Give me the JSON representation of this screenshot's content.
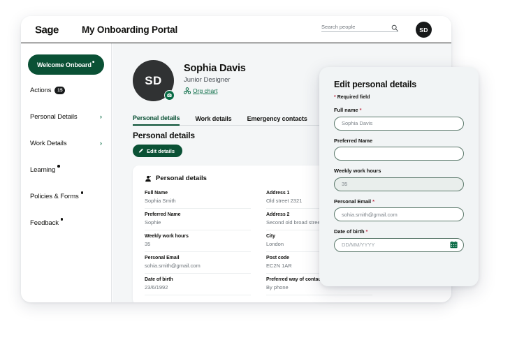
{
  "header": {
    "title": "My Onboarding Portal",
    "logo": "sage-logo",
    "user_initials": "SD",
    "search": {
      "placeholder": "Search people",
      "value": ""
    }
  },
  "sidebar": {
    "welcome": {
      "label": "Welcome Onboard",
      "has_dot": true,
      "active": true,
      "background_color": "#0a5135"
    },
    "items": [
      {
        "label": "Actions",
        "badge": "15"
      },
      {
        "label": "Personal Details",
        "chevron": "chevron-right-icon"
      },
      {
        "label": "Work Details",
        "chevron": "chevron-right-icon"
      },
      {
        "label": "Learning",
        "has_dot": true
      },
      {
        "label": "Policies & Forms",
        "has_dot": true
      },
      {
        "label": "Feedback",
        "has_dot": true
      }
    ]
  },
  "profile": {
    "initials": "SD",
    "name": "Sophia Davis",
    "role": "Junior Designer",
    "org_chart_label": "Org chart"
  },
  "tabs": [
    {
      "label": "Personal details",
      "active": true
    },
    {
      "label": "Work details",
      "active": false
    },
    {
      "label": "Emergency contacts",
      "active": false
    }
  ],
  "personal_details": {
    "section_title": "Personal details",
    "edit_button": "Edit details",
    "card_title": "Personal details",
    "left": [
      {
        "label": "Full Name",
        "value": "Sophia Smith"
      },
      {
        "label": "Preferred Name",
        "value": "Sophie"
      },
      {
        "label": "Weekly work hours",
        "value": "35"
      },
      {
        "label": "Personal Email",
        "value": "sohia.smith@gmail.com"
      },
      {
        "label": "Date of birth",
        "value": "23/6/1992"
      }
    ],
    "right": [
      {
        "label": "Address 1",
        "value": "Old street 2321"
      },
      {
        "label": "Address 2",
        "value": "Second old broad street"
      },
      {
        "label": "City",
        "value": "London"
      },
      {
        "label": "Post code",
        "value": "EC2N 1AR"
      },
      {
        "label": "Preferred way of contact",
        "value": "By phone"
      }
    ]
  },
  "modal": {
    "title": "Edit personal details",
    "required_note": "Required field",
    "fields": [
      {
        "label": "Full name",
        "value": "Sophia Davis",
        "required": true,
        "disabled": false
      },
      {
        "label": "Preferred Name",
        "value": "",
        "required": false,
        "disabled": false
      },
      {
        "label": "Weekly work hours",
        "value": "35",
        "required": false,
        "disabled": true
      },
      {
        "label": "Personal Email",
        "value": "sohia.smith@gmail.com",
        "required": true,
        "disabled": false
      },
      {
        "label": "Date of birth",
        "value": "",
        "placeholder": "DD/MM/YYYY",
        "required": true,
        "disabled": false,
        "icon": "calendar-icon"
      }
    ]
  },
  "colors": {
    "brand_green_dark": "#0a5135",
    "brand_green": "#0a6c46",
    "required_star": "#c0334a",
    "content_background": "#f4f6f7",
    "modal_background": "#f1f4f5",
    "avatar_dark": "#303233"
  }
}
